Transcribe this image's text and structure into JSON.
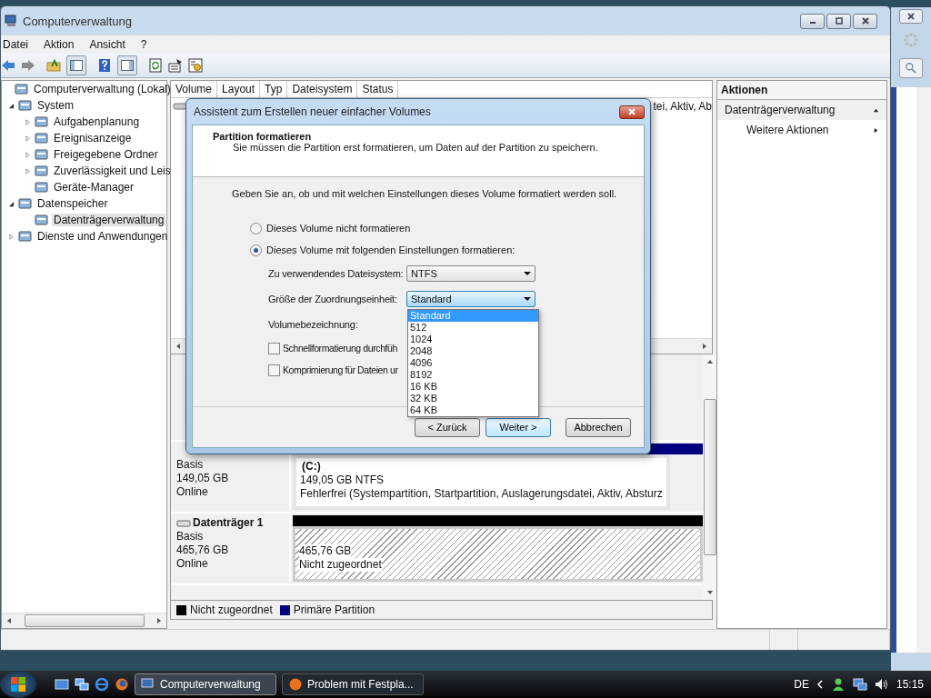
{
  "window": {
    "title": "Computerverwaltung"
  },
  "menu": [
    "Datei",
    "Aktion",
    "Ansicht",
    "?"
  ],
  "tree": [
    {
      "label": "Computerverwaltung (Lokal)",
      "selected": false,
      "children": [
        {
          "label": "System",
          "expanded": true,
          "selected": false,
          "children": [
            {
              "label": "Aufgabenplanung",
              "expanded": false,
              "selected": false
            },
            {
              "label": "Ereignisanzeige",
              "expanded": false,
              "selected": false
            },
            {
              "label": "Freigegebene Ordner",
              "expanded": false,
              "selected": false
            },
            {
              "label": "Zuverlässigkeit und Leis",
              "expanded": false,
              "selected": false
            },
            {
              "label": "Geräte-Manager",
              "selected": false
            }
          ]
        },
        {
          "label": "Datenspeicher",
          "expanded": true,
          "selected": false,
          "children": [
            {
              "label": "Datenträgerverwaltung",
              "selected": true
            }
          ]
        },
        {
          "label": "Dienste und Anwendungen",
          "expanded": false,
          "selected": false
        }
      ]
    }
  ],
  "table": {
    "columns": [
      "Volume",
      "Layout",
      "Typ",
      "Dateisystem",
      "Status"
    ],
    "rows": [
      {
        "status": "tei, Aktiv, Ab"
      }
    ]
  },
  "disks": [
    {
      "kind": "primary",
      "type": "Basis",
      "size": "149,05 GB",
      "status": "Online",
      "partition": {
        "label": "(C:)",
        "size": "149,05 GB NTFS",
        "status": "Fehlerfrei (Systempartition, Startpartition, Auslagerungsdatei, Aktiv, Absturz"
      }
    },
    {
      "kind": "unallocated",
      "name": "Datenträger 1",
      "type": "Basis",
      "size": "465,76 GB",
      "status": "Online",
      "partition": {
        "size": "465,76 GB",
        "status": "Nicht zugeordnet"
      }
    }
  ],
  "legend": [
    {
      "label": "Nicht zugeordnet",
      "color": "#000000"
    },
    {
      "label": "Primäre Partition",
      "color": "#000080"
    }
  ],
  "actions": {
    "title": "Aktionen",
    "sections": [
      {
        "label": "Datenträgerverwaltung",
        "expanded": true,
        "items": [
          "Weitere Aktionen"
        ]
      }
    ]
  },
  "dialog": {
    "title": "Assistent zum Erstellen neuer einfacher Volumes",
    "heading": "Partition formatieren",
    "subheading": "Sie müssen die Partition erst formatieren, um Daten auf der Partition zu speichern.",
    "instruction": "Geben Sie an, ob und mit welchen Einstellungen dieses Volume formatiert werden soll.",
    "options": [
      {
        "label": "Dieses Volume nicht formatieren",
        "selected": false
      },
      {
        "label": "Dieses Volume mit folgenden Einstellungen formatieren:",
        "selected": true
      }
    ],
    "fields": [
      {
        "kind": "dropdown",
        "label": "Zu verwendendes Dateisystem:",
        "value": "NTFS",
        "focused": false
      },
      {
        "kind": "dropdown",
        "label": "Größe der Zuordnungseinheit:",
        "value": "Standard",
        "focused": true,
        "options": [
          {
            "label": "Standard",
            "selected": true
          },
          {
            "label": "512",
            "selected": false
          },
          {
            "label": "1024",
            "selected": false
          },
          {
            "label": "2048",
            "selected": false
          },
          {
            "label": "4096",
            "selected": false
          },
          {
            "label": "8192",
            "selected": false
          },
          {
            "label": "16 KB",
            "selected": false
          },
          {
            "label": "32 KB",
            "selected": false
          },
          {
            "label": "64 KB",
            "selected": false
          }
        ]
      },
      {
        "kind": "label",
        "label": "Volumebezeichnung:"
      }
    ],
    "checkboxes": [
      {
        "label": "Schnellformatierung durchfüh",
        "checked": false
      },
      {
        "label": "Komprimierung für Dateien ur",
        "checked": false
      }
    ],
    "buttons": [
      {
        "label": "< Zurück",
        "default": false
      },
      {
        "label": "Weiter >",
        "default": true
      },
      {
        "label": "Abbrechen",
        "default": false
      }
    ]
  },
  "taskbar": {
    "buttons": [
      {
        "label": "Computerverwaltung",
        "selected": true
      },
      {
        "label": "Problem mit Festpla...",
        "selected": false
      }
    ],
    "language": "DE",
    "clock": "15:15"
  }
}
